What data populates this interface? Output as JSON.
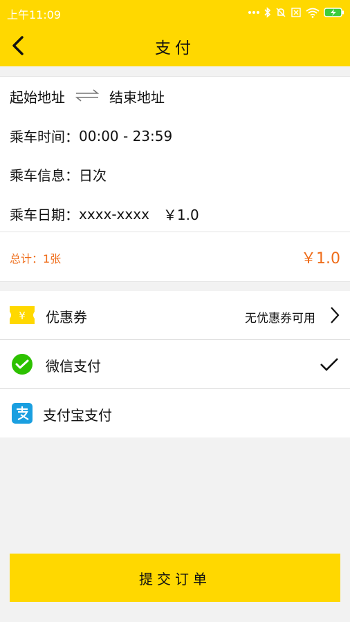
{
  "status_bar": {
    "time": "上午11:09",
    "icons": [
      "more-dots-icon",
      "bluetooth-icon",
      "mute-bell-icon",
      "no-sim-icon",
      "wifi-icon",
      "battery-charging-icon"
    ]
  },
  "app_bar": {
    "title": "支付",
    "back_icon": "chevron-left-icon"
  },
  "trip": {
    "start_address": "起始地址",
    "end_address": "结束地址",
    "time_label": "乘车时间",
    "time_value": "00:00 - 23:59",
    "info_label": "乘车信息",
    "info_value": "日次",
    "date_label": "乘车日期",
    "date_value": "xxxx-xxxx",
    "price": "￥1.0"
  },
  "total": {
    "label": "总计：1张",
    "amount": "￥1.0"
  },
  "payment": {
    "coupon": {
      "label": "优惠券",
      "status": "无优惠券可用",
      "icon": "coupon-ticket-icon"
    },
    "wechat": {
      "label": "微信支付",
      "icon": "wechat-pay-icon",
      "selected": true
    },
    "alipay": {
      "label": "支付宝支付",
      "icon": "alipay-icon",
      "selected": false
    }
  },
  "submit_label": "提交订单",
  "colors": {
    "brand_yellow": "#ffd800",
    "accent_orange": "#ef6d1a",
    "wechat_green": "#2dc100",
    "alipay_blue": "#1a9fe0",
    "background": "#f2f2f2"
  }
}
